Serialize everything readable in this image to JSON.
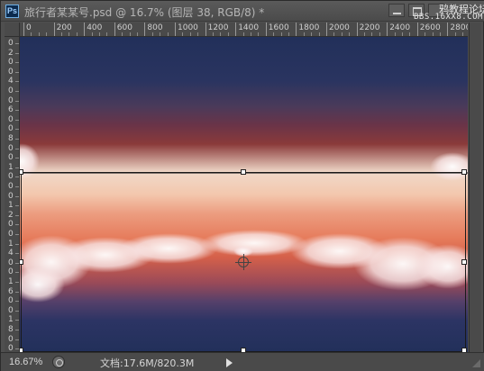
{
  "window": {
    "app_icon": "Ps",
    "title": "旅行者某某号.psd @ 16.7% (图层 38, RGB/8) *",
    "controls": {
      "minimize_icon": "minimize-icon",
      "maximize_icon": "maximize-icon",
      "close_icon": "close-icon"
    },
    "watermark": {
      "line1": "鸦教程论坛",
      "line2": "BBS.16XX8.COM"
    }
  },
  "ruler_top": {
    "labels": [
      "0",
      "200",
      "400",
      "600",
      "800",
      "1000",
      "1200",
      "1400",
      "1600",
      "1800",
      "2000",
      "2200",
      "2400",
      "2600",
      "2800"
    ]
  },
  "ruler_left": {
    "labels": [
      "0",
      "2",
      "0",
      "0",
      "4",
      "0",
      "0",
      "6",
      "0",
      "0",
      "8",
      "0",
      "0",
      "1",
      "0",
      "0",
      "0",
      "1",
      "2",
      "0",
      "0",
      "1",
      "4",
      "0",
      "0",
      "1",
      "6",
      "0",
      "0",
      "1",
      "8",
      "0",
      "0"
    ]
  },
  "status": {
    "zoom": "16.67%",
    "doc_info": "文档:17.6M/820.3M"
  },
  "colors": {
    "panel": "#4f4f4f",
    "sky_dark": "#22305a",
    "sunset": "#e67b5b",
    "horizon_light": "#f0d9c9"
  }
}
